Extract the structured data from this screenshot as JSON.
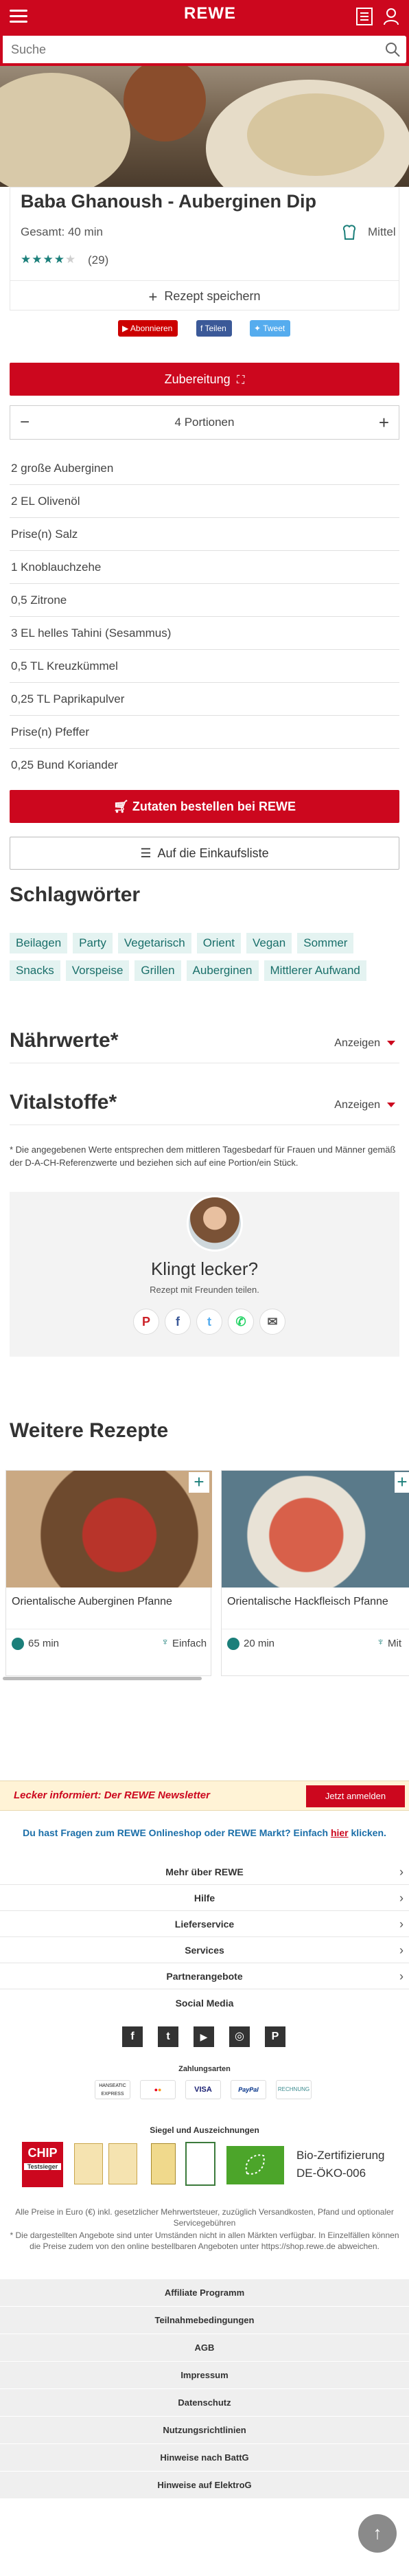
{
  "header": {
    "logo": "REWE",
    "menu_icon": "hamburger-icon",
    "list_icon": "shopping-list-icon",
    "user_icon": "user-icon"
  },
  "search": {
    "value": "Suche",
    "icon": "search-icon"
  },
  "recipe": {
    "title": "Baba Ghanoush - Auberginen Dip",
    "total_time": "Gesamt: 40 min",
    "difficulty": "Mittel",
    "rating_count": "(29)",
    "rating_stars": 4,
    "save_label": "Rezept speichern"
  },
  "social": {
    "youtube": "Abonnieren",
    "facebook": "Teilen",
    "twitter": "Tweet"
  },
  "preparation_label": "Zubereitung",
  "portions": {
    "minus": "−",
    "label": "4 Portionen",
    "plus": "+"
  },
  "ingredients": [
    "2 große Auberginen",
    "2 EL Olivenöl",
    "Prise(n) Salz",
    "1 Knoblauchzehe",
    "0,5 Zitrone",
    "3 EL helles Tahini (Sesammus)",
    "0,5 TL Kreuzkümmel",
    "0,25 TL Paprikapulver",
    "Prise(n) Pfeffer",
    "0,25 Bund Koriander"
  ],
  "order_button": {
    "prefix": "Zutaten bestellen bei",
    "brand": "REWE"
  },
  "shopping_list_button": "Auf die Einkaufsliste",
  "keywords": {
    "title": "Schlagwörter",
    "row1": [
      "Beilagen",
      "Party",
      "Vegetarisch",
      "Orient",
      "Vegan",
      "Sommer"
    ],
    "row2": [
      "Snacks",
      "Vorspeise",
      "Grillen",
      "Auberginen",
      "Mittlerer Aufwand"
    ]
  },
  "nutrition": {
    "title": "Nährwerte*",
    "action": "Anzeigen"
  },
  "vitals": {
    "title": "Vitalstoffe*",
    "action": "Anzeigen"
  },
  "footnote": "* Die angegebenen Werte entsprechen dem mittleren Tagesbedarf für Frauen und Männer gemäß der D-A-CH-Referenzwerte und beziehen sich auf eine Portion/ein Stück.",
  "share": {
    "title": "Klingt lecker?",
    "subtitle": "Rezept mit Freunden teilen."
  },
  "more_recipes": {
    "title": "Weitere Rezepte",
    "cards": [
      {
        "name": "Orientalische Auberginen Pfanne",
        "time": "65 min",
        "difficulty": "Einfach"
      },
      {
        "name": "Orientalische Hackfleisch Pfanne",
        "time": "20 min",
        "difficulty": "Mit"
      }
    ]
  },
  "newsletter": {
    "text": "Lecker informiert: Der REWE Newsletter",
    "button": "Jetzt anmelden"
  },
  "question": {
    "text": "Du hast Fragen zum REWE Onlineshop oder REWE Markt? Einfach",
    "link": "hier",
    "suffix": "klicken."
  },
  "footer_links": [
    "Mehr über REWE",
    "Hilfe",
    "Lieferservice",
    "Services",
    "Partnerangebote"
  ],
  "social_media": {
    "title": "Social Media",
    "icons": [
      "facebook-icon",
      "tumblr-icon",
      "youtube-icon",
      "instagram-icon",
      "pinterest-icon"
    ]
  },
  "payment": {
    "title": "Zahlungsarten",
    "methods": [
      "HANSEATIC EXPRESS",
      "Mastercard",
      "VISA",
      "PayPal",
      "RECHNUNG"
    ]
  },
  "seals": {
    "title": "Siegel und Auszeichnungen",
    "chip": "CHIP",
    "chip_sub": "Testsieger",
    "bio": "Bio-Zertifizierung",
    "bio_code": "DE-ÖKO-006"
  },
  "legal": {
    "text1": "Alle Preise in Euro (€) inkl. gesetzlicher Mehrwertsteuer, zuzüglich Versandkosten, Pfand und optionaler Servicegebühren",
    "text2": "* Die dargestellten Angebote sind unter Umständen nicht in allen Märkten verfügbar. In Einzelfällen können die Preise zudem von den online bestellbaren Angeboten unter https://shop.rewe.de abweichen."
  },
  "legal_links": [
    "Affiliate Programm",
    "Teilnahmebedingungen",
    "AGB",
    "Impressum",
    "Datenschutz",
    "Nutzungsrichtlinien",
    "Hinweise nach BattG",
    "Hinweise auf ElektroG"
  ],
  "colors": {
    "brand": "#cc071e",
    "accent": "#1b7f7a"
  }
}
